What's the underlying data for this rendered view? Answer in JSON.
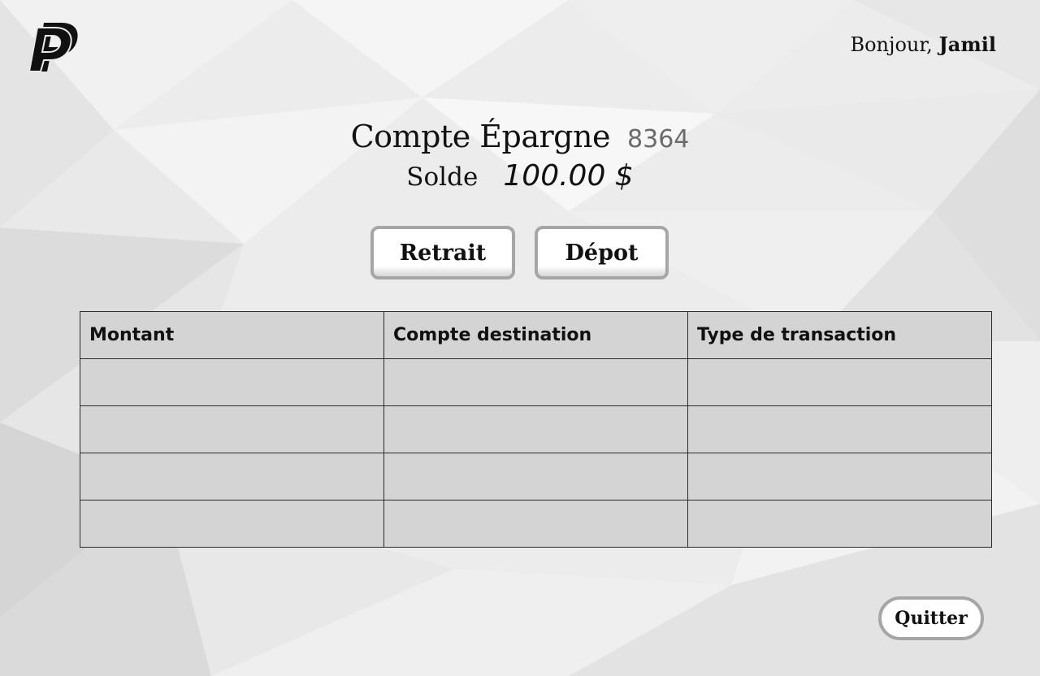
{
  "app": {
    "logo_icon": "paypal-logo-icon"
  },
  "header": {
    "greeting_prefix": "Bonjour,",
    "user_name": "Jamil"
  },
  "account": {
    "name": "Compte Épargne",
    "number": "8364",
    "balance_label": "Solde",
    "balance_value": "100.00 $"
  },
  "actions": {
    "withdraw_label": "Retrait",
    "deposit_label": "Dépot"
  },
  "transactions": {
    "columns": [
      "Montant",
      "Compte destination",
      "Type de transaction"
    ],
    "rows": [
      [
        "",
        "",
        ""
      ],
      [
        "",
        "",
        ""
      ],
      [
        "",
        "",
        ""
      ],
      [
        "",
        "",
        ""
      ]
    ]
  },
  "footer": {
    "quit_label": "Quitter"
  },
  "colors": {
    "background": "#e9e9e9",
    "table_fill": "#d4d4d4",
    "button_border": "#a6a6a6",
    "account_number": "#6b6b6b"
  }
}
